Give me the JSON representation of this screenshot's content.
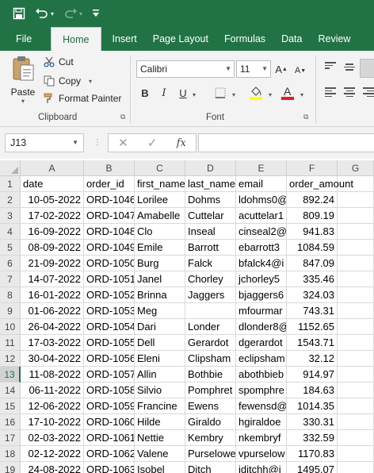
{
  "ribbon_tabs": [
    "File",
    "Home",
    "Insert",
    "Page Layout",
    "Formulas",
    "Data",
    "Review"
  ],
  "active_tab": "Home",
  "clipboard": {
    "paste": "Paste",
    "cut": "Cut",
    "copy": "Copy",
    "format_painter": "Format Painter",
    "group_label": "Clipboard"
  },
  "font": {
    "name": "Calibri",
    "size": "11",
    "group_label": "Font"
  },
  "formula_bar": {
    "name_box": "J13",
    "fx": "fx",
    "value": ""
  },
  "colors": {
    "accent": "#217346",
    "ribbon_bg": "#f3f3f3",
    "highlight_yellow": "#ffff00",
    "font_red": "#e02020"
  },
  "columns": [
    "A",
    "B",
    "C",
    "D",
    "E",
    "F",
    "G"
  ],
  "rows": [
    [
      "date",
      "order_id",
      "first_name",
      "last_name",
      "email",
      "order_amount"
    ],
    [
      "10-05-2022",
      "ORD-1046",
      "Lorilee",
      "Dohms",
      "ldohms0@",
      "892.24"
    ],
    [
      "17-02-2022",
      "ORD-1047",
      "Amabelle",
      "Cuttelar",
      "acuttelar1",
      "809.19"
    ],
    [
      "16-09-2022",
      "ORD-1048",
      "Clo",
      "Inseal",
      "cinseal2@",
      "941.83"
    ],
    [
      "08-09-2022",
      "ORD-1049",
      "Emile",
      "Barrott",
      "ebarrott3",
      "1084.59"
    ],
    [
      "21-09-2022",
      "ORD-1050",
      "Burg",
      "Falck",
      "bfalck4@i",
      "847.09"
    ],
    [
      "14-07-2022",
      "ORD-1051",
      "Janel",
      "Chorley",
      "jchorley5",
      "335.46"
    ],
    [
      "16-01-2022",
      "ORD-1052",
      "Brinna",
      "Jaggers",
      "bjaggers6",
      "324.03"
    ],
    [
      "01-06-2022",
      "ORD-1053",
      "Meg",
      "",
      "mfourmar",
      "743.31"
    ],
    [
      "26-04-2022",
      "ORD-1054",
      "Dari",
      "Londer",
      "dlonder8@",
      "1152.65"
    ],
    [
      "17-03-2022",
      "ORD-1055",
      "Dell",
      "Gerardot",
      "dgerardot",
      "1543.71"
    ],
    [
      "30-04-2022",
      "ORD-1056",
      "Eleni",
      "Clipsham",
      "eclipsham",
      "32.12"
    ],
    [
      "11-08-2022",
      "ORD-1057",
      "Allin",
      "Bothbie",
      "abothbieb",
      "914.97"
    ],
    [
      "06-11-2022",
      "ORD-1058",
      "Silvio",
      "Pomphret",
      "spomphre",
      "184.63"
    ],
    [
      "12-06-2022",
      "ORD-1059",
      "Francine",
      "Ewens",
      "fewensd@",
      "1014.35"
    ],
    [
      "17-10-2022",
      "ORD-1060",
      "Hilde",
      "Giraldo",
      "hgiraldoe",
      "330.31"
    ],
    [
      "02-03-2022",
      "ORD-1061",
      "Nettie",
      "Kembry",
      "nkembryf",
      "332.59"
    ],
    [
      "02-12-2022",
      "ORD-1062",
      "Valene",
      "Purselowe",
      "vpurselow",
      "1170.83"
    ],
    [
      "24-08-2022",
      "ORD-1063",
      "Isobel",
      "Ditch",
      "iditchh@i",
      "1495.07"
    ]
  ],
  "active_row": 13
}
